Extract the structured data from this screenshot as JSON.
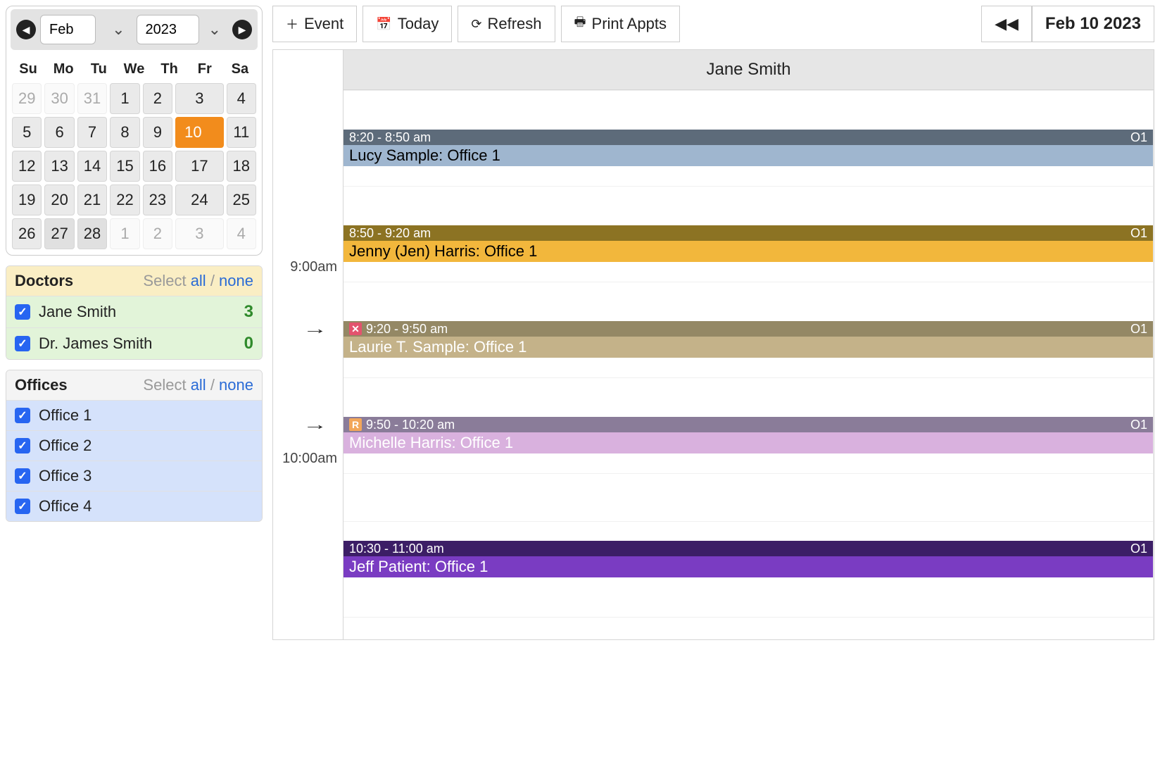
{
  "toolbar": {
    "event": "Event",
    "today": "Today",
    "refresh": "Refresh",
    "print": "Print Appts",
    "date": "Feb 10 2023"
  },
  "cal": {
    "month": "Feb",
    "year": "2023",
    "dow": [
      "Su",
      "Mo",
      "Tu",
      "We",
      "Th",
      "Fr",
      "Sa"
    ],
    "rows": [
      [
        {
          "n": "29",
          "m": true
        },
        {
          "n": "30",
          "m": true
        },
        {
          "n": "31",
          "m": true
        },
        {
          "n": "1"
        },
        {
          "n": "2"
        },
        {
          "n": "3"
        },
        {
          "n": "4"
        }
      ],
      [
        {
          "n": "5"
        },
        {
          "n": "6"
        },
        {
          "n": "7"
        },
        {
          "n": "8"
        },
        {
          "n": "9"
        },
        {
          "n": "10",
          "sel": true
        },
        {
          "n": "11"
        }
      ],
      [
        {
          "n": "12"
        },
        {
          "n": "13"
        },
        {
          "n": "14"
        },
        {
          "n": "15"
        },
        {
          "n": "16"
        },
        {
          "n": "17"
        },
        {
          "n": "18"
        }
      ],
      [
        {
          "n": "19"
        },
        {
          "n": "20"
        },
        {
          "n": "21"
        },
        {
          "n": "22"
        },
        {
          "n": "23"
        },
        {
          "n": "24"
        },
        {
          "n": "25"
        }
      ],
      [
        {
          "n": "26"
        },
        {
          "n": "27",
          "d": true
        },
        {
          "n": "28",
          "d": true
        },
        {
          "n": "1",
          "m": true
        },
        {
          "n": "2",
          "m": true
        },
        {
          "n": "3",
          "m": true
        },
        {
          "n": "4",
          "m": true
        }
      ]
    ]
  },
  "doctorsPanel": {
    "title": "Doctors",
    "selectLabel": "Select",
    "all": "all",
    "none": "none",
    "items": [
      {
        "name": "Jane Smith",
        "count": "3",
        "checked": true
      },
      {
        "name": "Dr. James Smith",
        "count": "0",
        "checked": true
      }
    ]
  },
  "officesPanel": {
    "title": "Offices",
    "selectLabel": "Select",
    "all": "all",
    "none": "none",
    "items": [
      {
        "name": "Office 1",
        "checked": true
      },
      {
        "name": "Office 2",
        "checked": true
      },
      {
        "name": "Office 3",
        "checked": true
      },
      {
        "name": "Office 4",
        "checked": true
      }
    ]
  },
  "schedule": {
    "column": "Jane Smith",
    "hours": [
      {
        "label": "9:00am",
        "topPx": 240
      },
      {
        "label": "10:00am",
        "topPx": 512
      }
    ],
    "arrows": [
      {
        "topPx": 326
      },
      {
        "topPx": 462
      }
    ],
    "appts": [
      {
        "time": "8:20 - 8:50 am",
        "text": "Lucy Sample: Office 1",
        "tag": "O1",
        "barColor": "#5d6b7a",
        "bodyColor": "#9fb6cf",
        "textColor": "#000",
        "topPx": 56,
        "heightPx": 128
      },
      {
        "time": "8:50 - 9:20 am",
        "text": "Jenny (Jen) Harris: Office 1",
        "tag": "O1",
        "barColor": "#8c7323",
        "bodyColor": "#f2b73c",
        "textColor": "#000",
        "topPx": 192,
        "heightPx": 128
      },
      {
        "time": "9:20 - 9:50 am",
        "text": "Laurie T. Sample: Office 1",
        "tag": "O1",
        "barColor": "#948865",
        "bodyColor": "#c4b289",
        "textColor": "#fff",
        "topPx": 328,
        "heightPx": 128,
        "flag": {
          "label": "✕",
          "bg": "#e3536e",
          "fg": "#fff"
        }
      },
      {
        "time": "9:50 - 10:20 am",
        "text": "Michelle Harris: Office 1",
        "tag": "O1",
        "barColor": "#8a7c99",
        "bodyColor": "#d9b1de",
        "textColor": "#fff",
        "topPx": 464,
        "heightPx": 128,
        "flag": {
          "label": "R",
          "bg": "#f2a65a",
          "fg": "#fff"
        }
      },
      {
        "time": "10:30 - 11:00 am",
        "text": "Jeff Patient: Office 1",
        "tag": "O1",
        "barColor": "#3c1e66",
        "bodyColor": "#7a3cc2",
        "textColor": "#fff",
        "topPx": 640,
        "heightPx": 140
      }
    ]
  }
}
